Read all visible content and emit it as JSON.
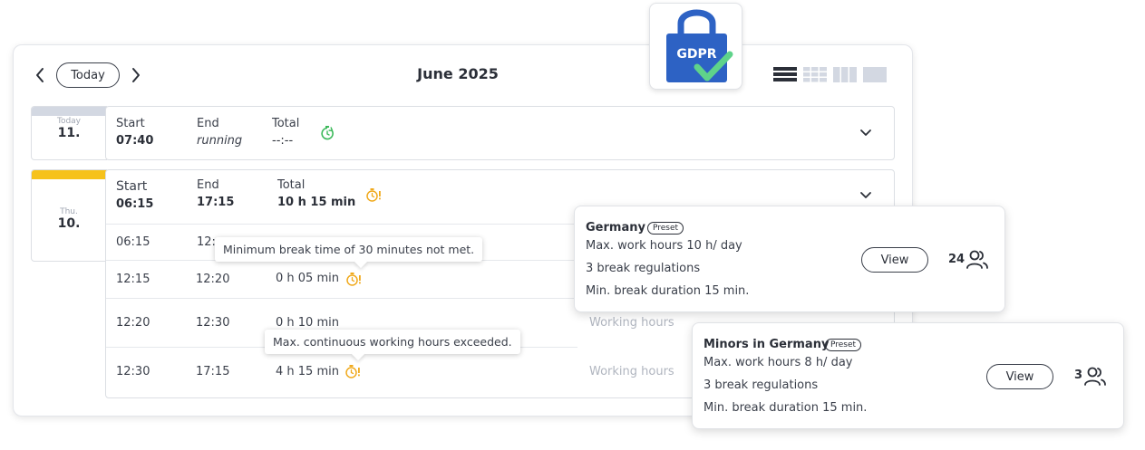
{
  "calendar": {
    "today_label": "Today",
    "month_title": "June 2025",
    "view_icons": [
      "list-view-icon",
      "week-view-icon",
      "month-view-icon",
      "year-view-icon"
    ]
  },
  "gdpr_badge": {
    "text": "GDPR"
  },
  "days": [
    {
      "weekday": "Today",
      "day": "11.",
      "band_color": "#d3d8e2",
      "start_label": "Start",
      "start_value": "07:40",
      "end_label": "End",
      "end_value": "running",
      "total_label": "Total",
      "total_value": "--:--",
      "status_icon": "running-timer-icon",
      "status_color": "#3cb95b"
    },
    {
      "weekday": "Thu.",
      "day": "10.",
      "band_color": "#f6c21b",
      "start_label": "Start",
      "start_value": "06:15",
      "end_label": "End",
      "end_value": "17:15",
      "total_label": "Total",
      "total_value": "10 h 15 min",
      "status_icon": "warning-timer-icon",
      "status_color": "#f0a91c",
      "entries": [
        {
          "start": "06:15",
          "end": "12:",
          "duration": "",
          "type": ""
        },
        {
          "start": "12:15",
          "end": "12:20",
          "duration": "0 h 05 min",
          "type": ""
        },
        {
          "start": "12:20",
          "end": "12:30",
          "duration": "0 h 10 min",
          "type": "Working hours"
        },
        {
          "start": "12:30",
          "end": "17:15",
          "duration": "4 h 15 min",
          "type": "Working hours"
        }
      ]
    }
  ],
  "tooltips": {
    "min_break": "Minimum break time of 30 minutes not met.",
    "max_continuous": "Max. continuous working hours exceeded."
  },
  "presets": [
    {
      "name": "Germany",
      "badge": "Preset",
      "line1": "Max. work hours 10 h/ day",
      "line2": "3 break regulations",
      "line3": "Min. break duration 15 min.",
      "button": "View",
      "count": "24"
    },
    {
      "name": "Minors in Germany",
      "badge": "Preset",
      "line1": "Max. work hours 8 h/ day",
      "line2": "3 break regulations",
      "line3": "Min. break duration 15 min.",
      "button": "View",
      "count": "3"
    }
  ],
  "colors": {
    "accent_blue": "#2d62c4",
    "check_green": "#5fd38a",
    "warning_orange": "#f0a91c",
    "running_green": "#3cb95b"
  }
}
